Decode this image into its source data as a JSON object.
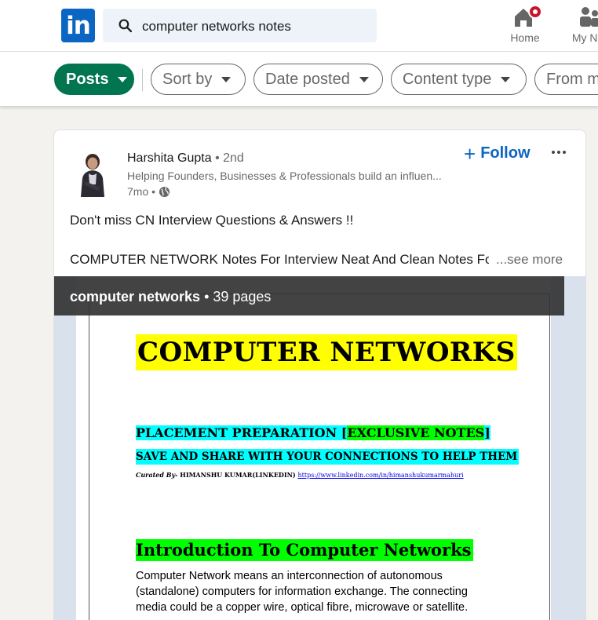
{
  "nav": {
    "logo_text": "in",
    "search_value": "computer networks notes",
    "home_label": "Home",
    "network_label": "My Net"
  },
  "filters": {
    "posts": "Posts",
    "sort_by": "Sort by",
    "date_posted": "Date posted",
    "content_type": "Content type",
    "from": "From m"
  },
  "post": {
    "author": "Harshita Gupta",
    "degree": "• 2nd",
    "headline": "Helping Founders, Businesses & Professionals build an influen...",
    "time": "7mo •",
    "follow_label": "Follow",
    "text_line1": "Don't miss CN Interview Questions & Answers !!",
    "text_line2": "COMPUTER NETWORK Notes For Interview Neat And Clean Notes For",
    "see_more": "...see more"
  },
  "document": {
    "name": "computer networks",
    "pages": "• 39 pages",
    "title": "COMPUTER NETWORKS",
    "sub1_a": "PLACEMENT PREPARATION [",
    "sub1_b": "EXCLUSIVE NOTES",
    "sub1_c": "]",
    "sub2": "SAVE AND SHARE WITH YOUR CONNECTIONS TO HELP THEM",
    "curated_label": "Curated By-",
    "curated_name": " HIMANSHU KUMAR(LINKEDIN) ",
    "curated_link": "https://www.linkedin.com/in/himanshukumarmahuri",
    "intro_heading": "Introduction To Computer Networks",
    "body": "Computer Network means an interconnection of autonomous (standalone) computers for information exchange. The connecting media could be a copper wire, optical fibre, microwave or satellite."
  },
  "colors": {
    "brand": "#0a66c2",
    "posts_pill": "#01754f",
    "badge": "#cb112d",
    "highlight_yellow": "#ffff00",
    "highlight_cyan": "#00ffff",
    "highlight_green": "#00ff00"
  },
  "icons": [
    "search-icon",
    "home-icon",
    "network-icon",
    "globe-icon",
    "more-options-icon",
    "plus-icon",
    "caret-down-icon"
  ]
}
